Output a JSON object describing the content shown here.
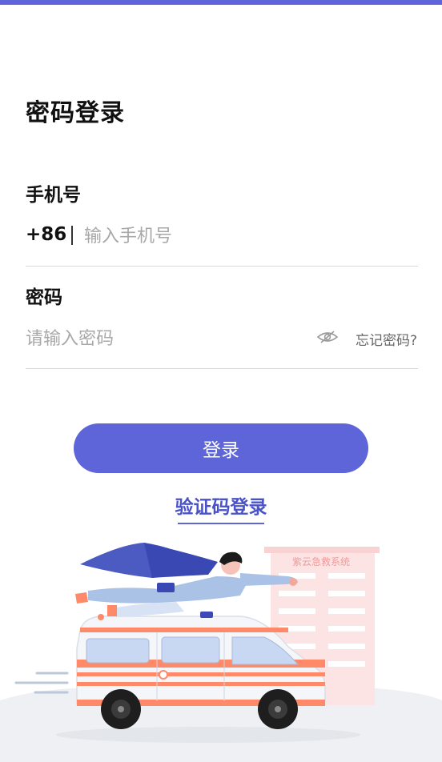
{
  "colors": {
    "accent": "#5e65d8",
    "accent_text": "#4a52c9"
  },
  "page": {
    "title": "密码登录"
  },
  "phone": {
    "label": "手机号",
    "country_code": "+86",
    "placeholder": "输入手机号",
    "value": ""
  },
  "password": {
    "label": "密码",
    "placeholder": "请输入密码",
    "value": "",
    "visibility_icon": "eye-slash-icon",
    "forgot_label": "忘记密码?"
  },
  "actions": {
    "login_label": "登录",
    "sms_login_label": "验证码登录"
  },
  "illustration": {
    "building_sign": "紫云急救系统"
  }
}
